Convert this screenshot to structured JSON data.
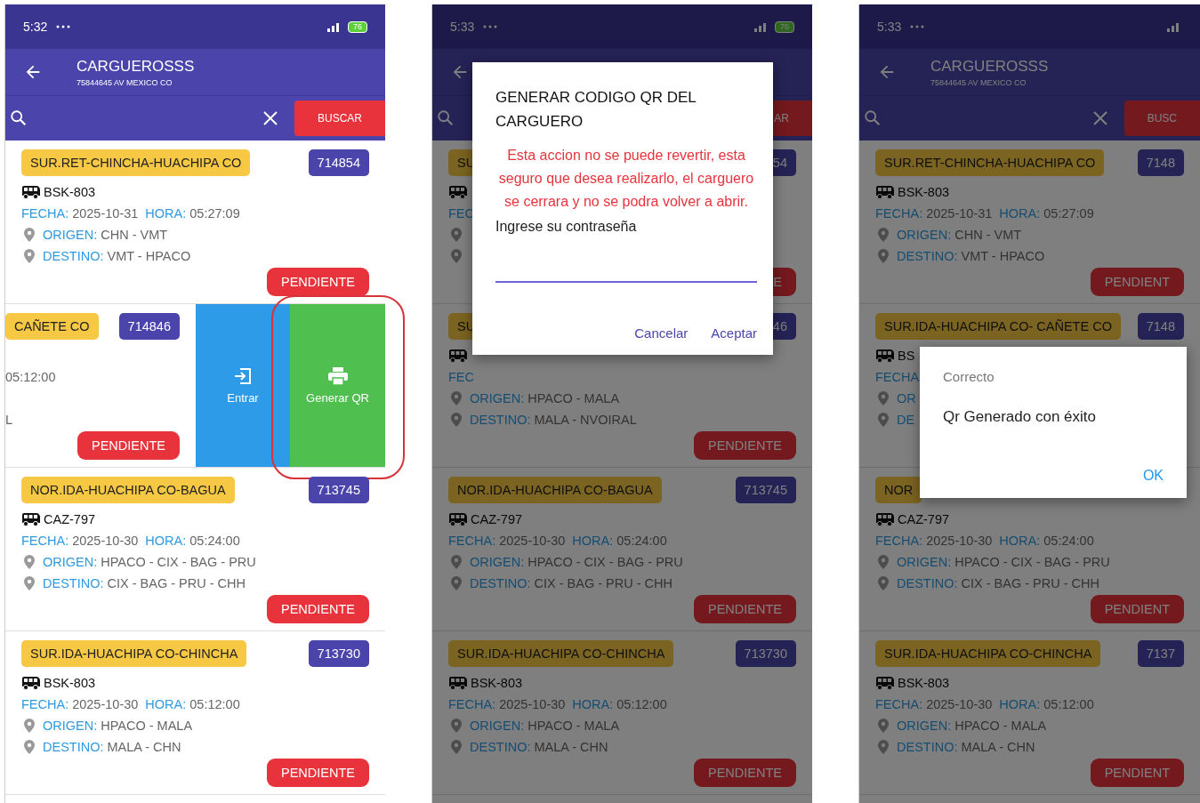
{
  "screens": [
    {
      "status_bar": {
        "time": "5:32",
        "battery": "76"
      },
      "header": {
        "title": "CARGUEROSSS",
        "subtitle": "75844645 AV MEXICO CO"
      },
      "search": {
        "clear": true,
        "button": "BUSCAR"
      },
      "cards": [
        {
          "kind": "normal",
          "route": "SUR.RET-CHINCHA-HUACHIPA CO",
          "code": "714854",
          "lines": [
            {
              "kind": "vehicle",
              "value": "BSK-803"
            },
            {
              "kind": "datetime",
              "label": "FECHA:",
              "value": "2025-10-31",
              "label2": "HORA:",
              "value2": "05:27:09"
            },
            {
              "kind": "place",
              "label": "ORIGEN:",
              "value": "CHN - VMT"
            },
            {
              "kind": "place",
              "label": "DESTINO:",
              "value": "VMT - HPACO"
            }
          ],
          "status": "PENDIENTE"
        },
        {
          "kind": "swiped",
          "route": "CAÑETE CO",
          "code": "714846",
          "lines": [
            {
              "kind": "gap"
            },
            {
              "kind": "text",
              "value": "05:12:00"
            },
            {
              "kind": "gap"
            },
            {
              "kind": "text",
              "value": "L"
            }
          ],
          "status": "PENDIENTE",
          "actions": [
            {
              "kind": "enter",
              "label": "Entrar",
              "highlighted": false
            },
            {
              "kind": "print",
              "label": "Generar QR",
              "highlighted": true
            }
          ]
        },
        {
          "kind": "normal",
          "route": "NOR.IDA-HUACHIPA CO-BAGUA",
          "code": "713745",
          "lines": [
            {
              "kind": "vehicle",
              "value": "CAZ-797"
            },
            {
              "kind": "datetime",
              "label": "FECHA:",
              "value": "2025-10-30",
              "label2": "HORA:",
              "value2": "05:24:00"
            },
            {
              "kind": "place",
              "label": "ORIGEN:",
              "value": "HPACO - CIX - BAG - PRU"
            },
            {
              "kind": "place",
              "label": "DESTINO:",
              "value": "CIX - BAG - PRU - CHH"
            }
          ],
          "status": "PENDIENTE"
        },
        {
          "kind": "normal",
          "route": "SUR.IDA-HUACHIPA CO-CHINCHA",
          "code": "713730",
          "lines": [
            {
              "kind": "vehicle",
              "value": "BSK-803"
            },
            {
              "kind": "datetime",
              "label": "FECHA:",
              "value": "2025-10-30",
              "label2": "HORA:",
              "value2": "05:12:00"
            },
            {
              "kind": "place",
              "label": "ORIGEN:",
              "value": "HPACO - MALA"
            },
            {
              "kind": "place",
              "label": "DESTINO:",
              "value": "MALA - CHN"
            }
          ],
          "status": "PENDIENTE"
        }
      ]
    },
    {
      "status_bar": {
        "time": "5:33",
        "battery": "76"
      },
      "search": {
        "button": "AR"
      },
      "cards": [
        {
          "kind": "normal",
          "route": "SU",
          "code": "54",
          "lines": [
            {
              "kind": "vehicle"
            },
            {
              "kind": "datetime",
              "label": "FEC"
            },
            {
              "kind": "place"
            },
            {
              "kind": "place"
            }
          ],
          "status": "E"
        },
        {
          "kind": "normal",
          "route": "SU",
          "code": "46",
          "lines": [
            {
              "kind": "vehicle"
            },
            {
              "kind": "datetime",
              "label": "FEC"
            },
            {
              "kind": "place",
              "label": "ORIGEN:",
              "value": "HPACO - MALA"
            },
            {
              "kind": "place",
              "label": "DESTINO:",
              "value": "MALA - NVOIRAL"
            }
          ],
          "status": "PENDIENTE"
        },
        {
          "kind": "normal",
          "route": "NOR.IDA-HUACHIPA CO-BAGUA",
          "code": "713745",
          "lines": [
            {
              "kind": "vehicle",
              "value": "CAZ-797"
            },
            {
              "kind": "datetime",
              "label": "FECHA:",
              "value": "2025-10-30",
              "label2": "HORA:",
              "value2": "05:24:00"
            },
            {
              "kind": "place",
              "label": "ORIGEN:",
              "value": "HPACO - CIX - BAG - PRU"
            },
            {
              "kind": "place",
              "label": "DESTINO:",
              "value": "CIX - BAG - PRU - CHH"
            }
          ],
          "status": "PENDIENTE"
        },
        {
          "kind": "normal",
          "route": "SUR.IDA-HUACHIPA CO-CHINCHA",
          "code": "713730",
          "lines": [
            {
              "kind": "vehicle",
              "value": "BSK-803"
            },
            {
              "kind": "datetime",
              "label": "FECHA:",
              "value": "2025-10-30",
              "label2": "HORA:",
              "value2": "05:12:00"
            },
            {
              "kind": "place",
              "label": "ORIGEN:",
              "value": "HPACO - MALA"
            },
            {
              "kind": "place",
              "label": "DESTINO:",
              "value": "MALA - CHN"
            }
          ],
          "status": "PENDIENTE"
        }
      ],
      "dialog": {
        "kind": "confirm",
        "title": "GENERAR CODIGO QR DEL CARGUERO",
        "message": "Esta accion no se puede revertir, esta seguro que desea realizarlo, el carguero se cerrara y no se podra volver a abrir.",
        "field_label": "Ingrese su contraseña",
        "buttons": [
          "Cancelar",
          "Aceptar"
        ]
      }
    },
    {
      "status_bar": {
        "time": "5:33"
      },
      "header": {
        "title": "CARGUEROSSS",
        "subtitle": "75844645 AV MEXICO CO"
      },
      "search": {
        "clear": true,
        "button": "BUSC"
      },
      "cards": [
        {
          "kind": "normal",
          "route": "SUR.RET-CHINCHA-HUACHIPA CO",
          "code": "7148",
          "lines": [
            {
              "kind": "vehicle",
              "value": "BSK-803"
            },
            {
              "kind": "datetime",
              "label": "FECHA:",
              "value": "2025-10-31",
              "label2": "HORA:",
              "value2": "05:27:09"
            },
            {
              "kind": "place",
              "label": "ORIGEN:",
              "value": "CHN - VMT"
            },
            {
              "kind": "place",
              "label": "DESTINO:",
              "value": "VMT - HPACO"
            }
          ],
          "status": "PENDIENT"
        },
        {
          "kind": "normal",
          "route": "SUR.IDA-HUACHIPA CO- CAÑETE CO",
          "code": "7148",
          "lines": [
            {
              "kind": "vehicle",
              "value": "BS"
            },
            {
              "kind": "datetime",
              "label": "FECHA"
            },
            {
              "kind": "place",
              "label": "OR"
            },
            {
              "kind": "place",
              "label": "DE"
            }
          ]
        },
        {
          "kind": "normal",
          "route": "NOR",
          "lines": [
            {
              "kind": "vehicle",
              "value": "CAZ-797"
            },
            {
              "kind": "datetime",
              "label": "FECHA:",
              "value": "2025-10-30",
              "label2": "HORA:",
              "value2": "05:24:00"
            },
            {
              "kind": "place",
              "label": "ORIGEN:",
              "value": "HPACO - CIX - BAG - PRU"
            },
            {
              "kind": "place",
              "label": "DESTINO:",
              "value": "CIX - BAG - PRU - CHH"
            }
          ],
          "status": "PENDIENT"
        },
        {
          "kind": "normal",
          "route": "SUR.IDA-HUACHIPA CO-CHINCHA",
          "code": "7137",
          "lines": [
            {
              "kind": "vehicle",
              "value": "BSK-803"
            },
            {
              "kind": "datetime",
              "label": "FECHA:",
              "value": "2025-10-30",
              "label2": "HORA:",
              "value2": "05:12:00"
            },
            {
              "kind": "place",
              "label": "ORIGEN:",
              "value": "HPACO - MALA"
            },
            {
              "kind": "place",
              "label": "DESTINO:",
              "value": "MALA - CHN"
            }
          ],
          "status": "PENDIENT"
        }
      ],
      "dialog": {
        "kind": "alert",
        "title": "Correcto",
        "message": "Qr Generado con éxito",
        "buttons": [
          "OK"
        ]
      }
    }
  ]
}
